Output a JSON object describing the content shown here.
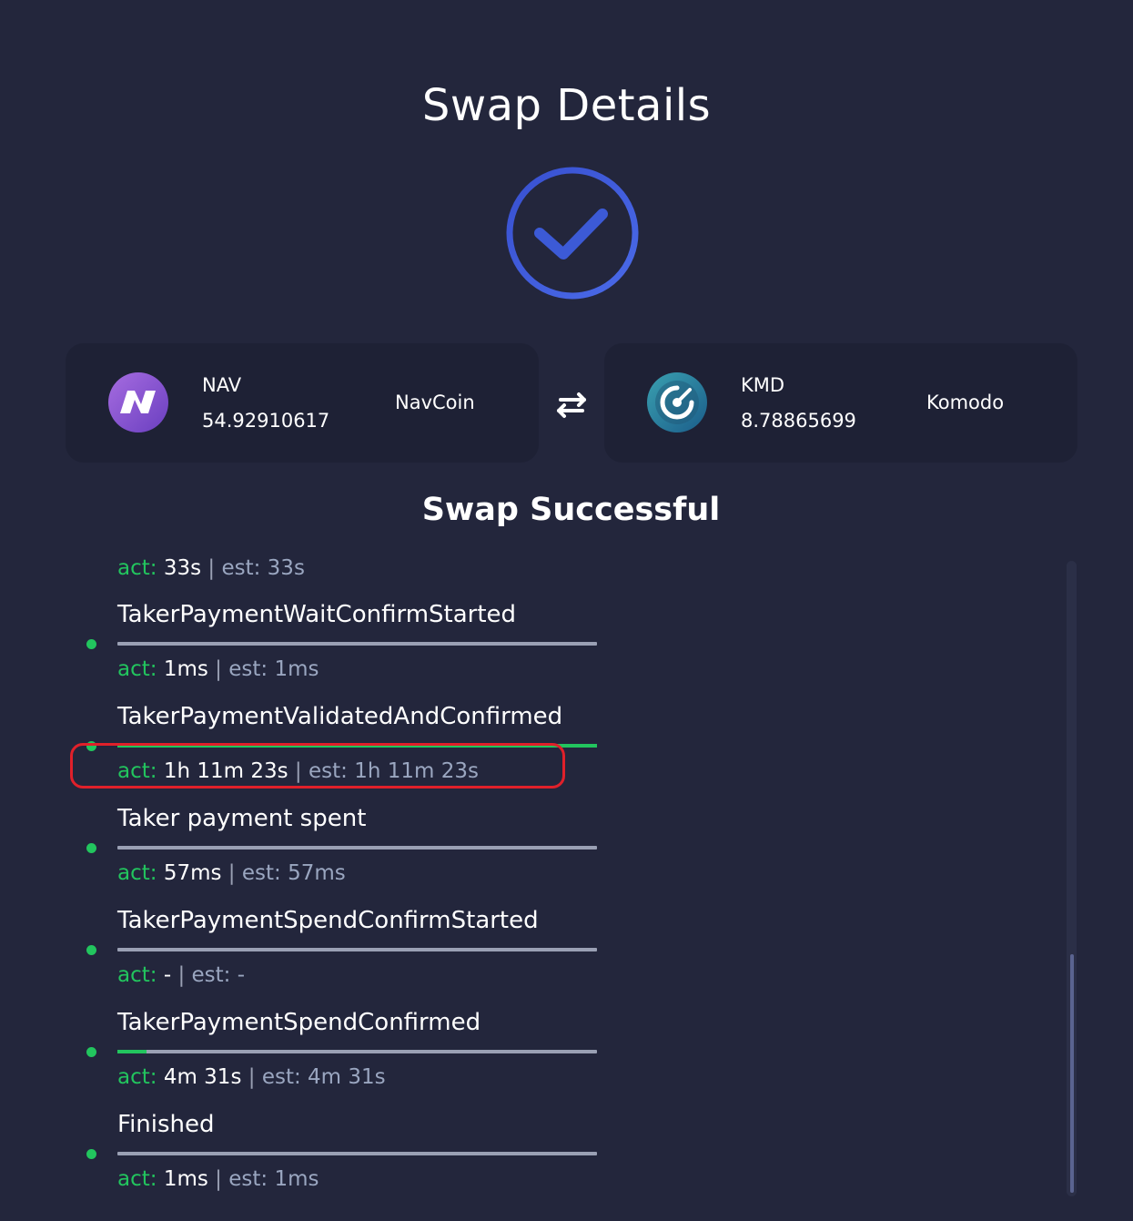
{
  "page": {
    "title": "Swap Details",
    "status": "Swap Successful"
  },
  "colors": {
    "background": "#23263c",
    "card": "#1e2135",
    "success_ring": "#3b5bdb",
    "success_green": "#22c55e",
    "highlight_red": "#e0202a"
  },
  "swap": {
    "icon": "swap-arrows-icon",
    "from": {
      "ticker": "NAV",
      "amount": "54.92910617",
      "name": "NavCoin",
      "icon": "navcoin-logo-icon"
    },
    "to": {
      "ticker": "KMD",
      "amount": "8.78865699",
      "name": "Komodo",
      "icon": "komodo-logo-icon"
    }
  },
  "timing_labels": {
    "act": "act:",
    "est": "est:",
    "sep": "|"
  },
  "first_timing": {
    "act": "33s",
    "est": "33s"
  },
  "events": [
    {
      "name": "TakerPaymentWaitConfirmStarted",
      "progress": 0.0,
      "act": "1ms",
      "est": "1ms"
    },
    {
      "name": "TakerPaymentValidatedAndConfirmed",
      "progress": 1.0,
      "act": "1h 11m 23s",
      "est": "1h 11m 23s"
    },
    {
      "name": "Taker payment spent",
      "progress": 0.0,
      "act": "57ms",
      "est": "57ms"
    },
    {
      "name": "TakerPaymentSpendConfirmStarted",
      "progress": 0.0,
      "act": "-",
      "est": "-"
    },
    {
      "name": "TakerPaymentSpendConfirmed",
      "progress": 0.06,
      "act": "4m 31s",
      "est": "4m 31s"
    },
    {
      "name": "Finished",
      "progress": 0.0,
      "act": "1ms",
      "est": "1ms"
    }
  ]
}
